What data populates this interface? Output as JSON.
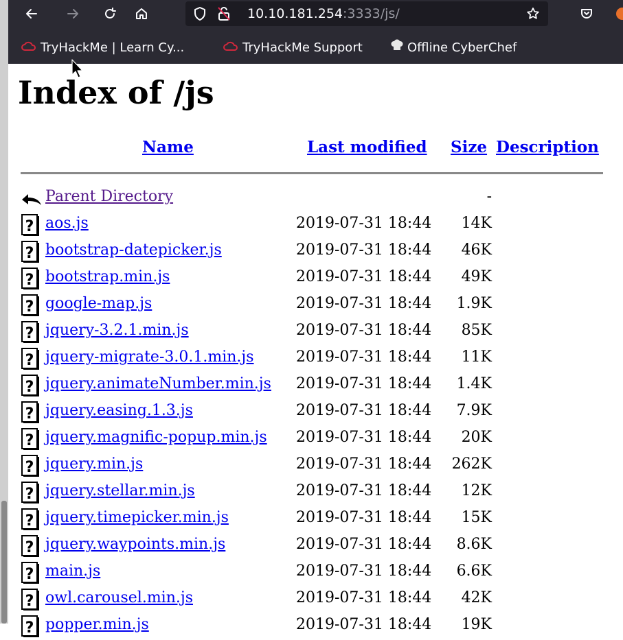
{
  "browser": {
    "url_host": "10.10.181.254",
    "url_rest": ":3333/js/",
    "bookmarks": [
      {
        "label": "TryHackMe | Learn Cy...",
        "icon": "thm-cloud-icon"
      },
      {
        "label": "TryHackMe Support",
        "icon": "thm-cloud-icon"
      },
      {
        "label": "Offline CyberChef",
        "icon": "chef-hat-icon"
      }
    ]
  },
  "page": {
    "title": "Index of /js",
    "headers": {
      "name": "Name",
      "modified": "Last modified",
      "size": "Size",
      "description": "Description"
    },
    "parent": {
      "label": "Parent Directory",
      "size": "-"
    },
    "files": [
      {
        "name": "aos.js",
        "modified": "2019-07-31 18:44",
        "size": "14K"
      },
      {
        "name": "bootstrap-datepicker.js",
        "modified": "2019-07-31 18:44",
        "size": "46K"
      },
      {
        "name": "bootstrap.min.js",
        "modified": "2019-07-31 18:44",
        "size": "49K"
      },
      {
        "name": "google-map.js",
        "modified": "2019-07-31 18:44",
        "size": "1.9K"
      },
      {
        "name": "jquery-3.2.1.min.js",
        "modified": "2019-07-31 18:44",
        "size": "85K"
      },
      {
        "name": "jquery-migrate-3.0.1.min.js",
        "modified": "2019-07-31 18:44",
        "size": "11K"
      },
      {
        "name": "jquery.animateNumber.min.js",
        "modified": "2019-07-31 18:44",
        "size": "1.4K"
      },
      {
        "name": "jquery.easing.1.3.js",
        "modified": "2019-07-31 18:44",
        "size": "7.9K"
      },
      {
        "name": "jquery.magnific-popup.min.js",
        "modified": "2019-07-31 18:44",
        "size": "20K"
      },
      {
        "name": "jquery.min.js",
        "modified": "2019-07-31 18:44",
        "size": "262K"
      },
      {
        "name": "jquery.stellar.min.js",
        "modified": "2019-07-31 18:44",
        "size": "12K"
      },
      {
        "name": "jquery.timepicker.min.js",
        "modified": "2019-07-31 18:44",
        "size": "15K"
      },
      {
        "name": "jquery.waypoints.min.js",
        "modified": "2019-07-31 18:44",
        "size": "8.6K"
      },
      {
        "name": "main.js",
        "modified": "2019-07-31 18:44",
        "size": "6.6K"
      },
      {
        "name": "owl.carousel.min.js",
        "modified": "2019-07-31 18:44",
        "size": "42K"
      },
      {
        "name": "popper.min.js",
        "modified": "2019-07-31 18:44",
        "size": "19K"
      }
    ]
  }
}
